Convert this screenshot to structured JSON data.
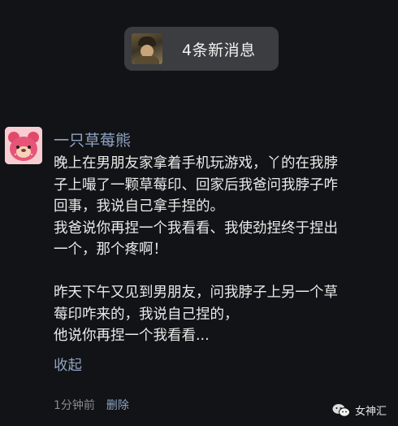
{
  "notification": {
    "text": "4条新消息",
    "avatar_icon": "user-photo-icon"
  },
  "post": {
    "author": "一只草莓熊",
    "avatar_icon": "strawberry-bear-icon",
    "lines": [
      "晚上在男朋友家拿着手机玩游戏，丫的在我脖",
      "子上嘬了一颗草莓印、回家后我爸问我脖子咋",
      "回事，我说自己拿手捏的。",
      "我爸说你再捏一个我看看、我使劲捏终于捏出",
      "一个，那个疼啊！",
      "",
      "昨天下午又见到男朋友，问我脖子上另一个草",
      "莓印咋来的，我说自己捏的，",
      "他说你再捏一个我看看..."
    ],
    "collapse_label": "收起",
    "time": "1分钟前",
    "delete_label": "删除"
  },
  "watermark": {
    "text": "女神汇",
    "icon": "wechat-icon"
  },
  "colors": {
    "background": "#121316",
    "link": "#8ea3c2",
    "bubble": "#3c3d41"
  }
}
